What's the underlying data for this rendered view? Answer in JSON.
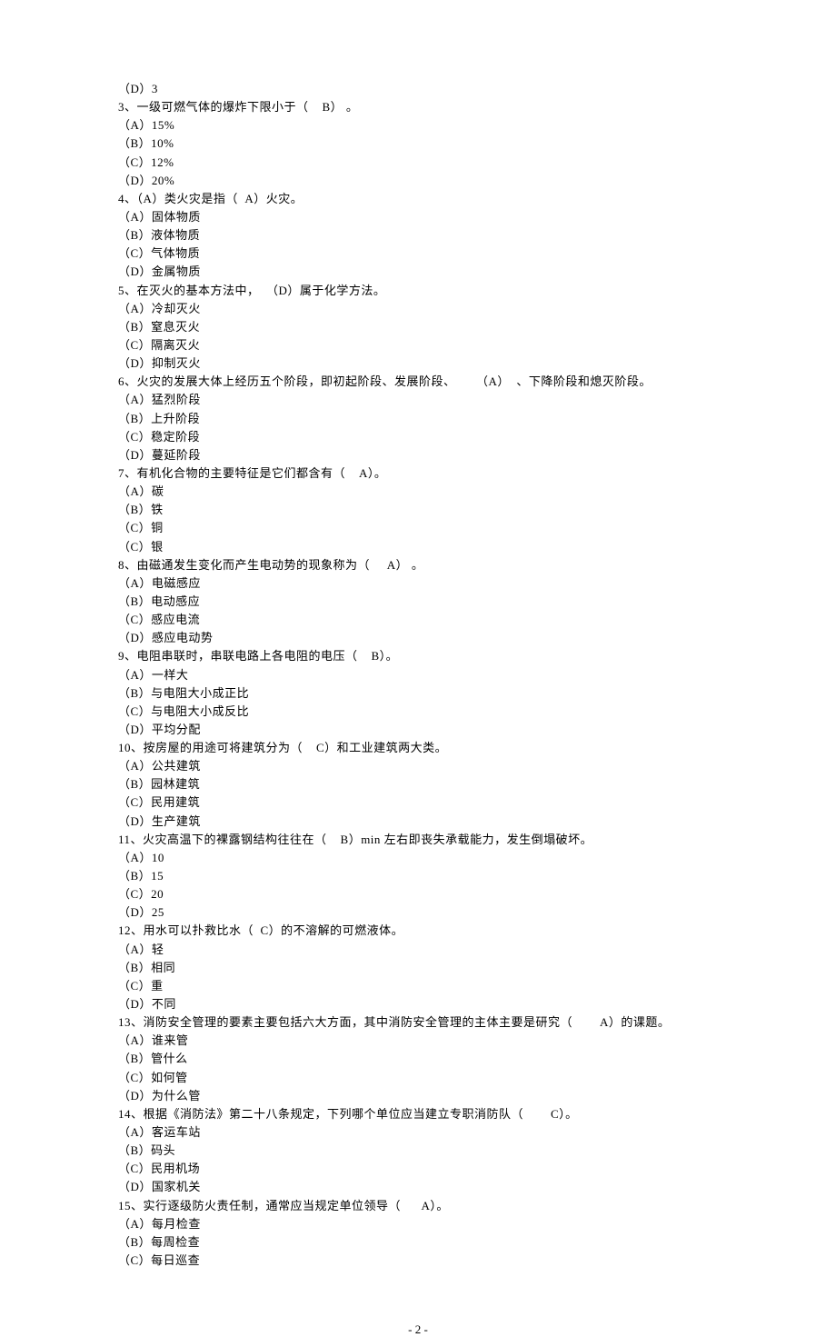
{
  "lines": [
    "（D）3",
    "3、一级可燃气体的爆炸下限小于（    B） 。",
    "（A）15%",
    "（B）10%",
    "（C）12%",
    "（D）20%",
    "4、（A）类火灾是指（  A）火灾。",
    "（A）固体物质",
    "（B）液体物质",
    "（C）气体物质",
    "（D）金属物质",
    "5、在灭火的基本方法中，  （D）属于化学方法。",
    "（A）冷却灭火",
    "（B）窒息灭火",
    "（C）隔离灭火",
    "（D）抑制灭火",
    "6、火灾的发展大体上经历五个阶段，即初起阶段、发展阶段、      （A）  、下降阶段和熄灭阶段。",
    "（A）猛烈阶段",
    "（B）上升阶段",
    "（C）稳定阶段",
    "（D）蔓延阶段",
    "7、有机化合物的主要特征是它们都含有（    A）。",
    "（A）碳",
    "（B）铁",
    "（C）铜",
    "（C）银",
    "8、由磁通发生变化而产生电动势的现象称为（     A） 。",
    "（A）电磁感应",
    "（B）电动感应",
    "（C）感应电流",
    "（D）感应电动势",
    "9、电阻串联时，串联电路上各电阻的电压（    B）。",
    "（A）一样大",
    "（B）与电阻大小成正比",
    "（C）与电阻大小成反比",
    "（D）平均分配",
    "10、按房屋的用途可将建筑分为（    C）和工业建筑两大类。",
    "（A）公共建筑",
    "（B）园林建筑",
    "（C）民用建筑",
    "（D）生产建筑",
    "11、火灾高温下的裸露钢结构往往在（    B）min 左右即丧失承载能力，发生倒塌破坏。",
    "（A）10",
    "（B）15",
    "（C）20",
    "（D）25",
    "12、用水可以扑救比水（  C）的不溶解的可燃液体。",
    "（A）轻",
    "（B）相同",
    "（C）重",
    "（D）不同",
    "13、消防安全管理的要素主要包括六大方面，其中消防安全管理的主体主要是研究（        A）的课题。",
    "（A）谁来管",
    "（B）管什么",
    "（C）如何管",
    "（D）为什么管",
    "14、根据《消防法》第二十八条规定，下列哪个单位应当建立专职消防队（        C）。",
    "（A）客运车站",
    "（B）码头",
    "（C）民用机场",
    "（D）国家机关",
    "15、实行逐级防火责任制，通常应当规定单位领导（      A）。",
    "（A）每月检查",
    "（B）每周检查",
    "（C）每日巡查"
  ],
  "pageNumber": "- 2 -"
}
